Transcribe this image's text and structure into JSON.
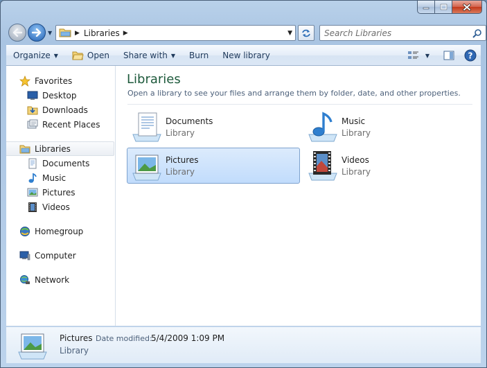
{
  "window": {
    "caption_buttons": [
      "minimize-icon",
      "maximize-icon",
      "close-icon"
    ]
  },
  "navbar": {
    "address_crumb": "Libraries",
    "search_placeholder": "Search Libraries"
  },
  "toolbar": {
    "organize": "Organize",
    "open": "Open",
    "share_with": "Share with",
    "burn": "Burn",
    "new_library": "New library"
  },
  "sidebar": {
    "favorites": {
      "label": "Favorites",
      "items": [
        {
          "label": "Desktop",
          "icon": "desktop-icon"
        },
        {
          "label": "Downloads",
          "icon": "downloads-folder-icon"
        },
        {
          "label": "Recent Places",
          "icon": "recent-places-icon"
        }
      ]
    },
    "libraries": {
      "label": "Libraries",
      "items": [
        {
          "label": "Documents",
          "icon": "documents-icon"
        },
        {
          "label": "Music",
          "icon": "music-icon"
        },
        {
          "label": "Pictures",
          "icon": "pictures-icon"
        },
        {
          "label": "Videos",
          "icon": "videos-icon"
        }
      ]
    },
    "homegroup": "Homegroup",
    "computer": "Computer",
    "network": "Network"
  },
  "main": {
    "title": "Libraries",
    "description": "Open a library to see your files and arrange them by folder, date, and other properties.",
    "libraries": [
      {
        "name": "Documents",
        "type": "Library",
        "icon": "documents-library-icon",
        "selected": false
      },
      {
        "name": "Music",
        "type": "Library",
        "icon": "music-library-icon",
        "selected": false
      },
      {
        "name": "Pictures",
        "type": "Library",
        "icon": "pictures-library-icon",
        "selected": true
      },
      {
        "name": "Videos",
        "type": "Library",
        "icon": "videos-library-icon",
        "selected": false
      }
    ]
  },
  "details": {
    "name": "Pictures",
    "modified_label": "Date modified:",
    "modified_value": "5/4/2009 1:09 PM",
    "type": "Library"
  },
  "colors": {
    "title_green": "#1e5a3c",
    "selection_blue": "#c1dcfc",
    "frame_blue": "#a9c4e2"
  }
}
